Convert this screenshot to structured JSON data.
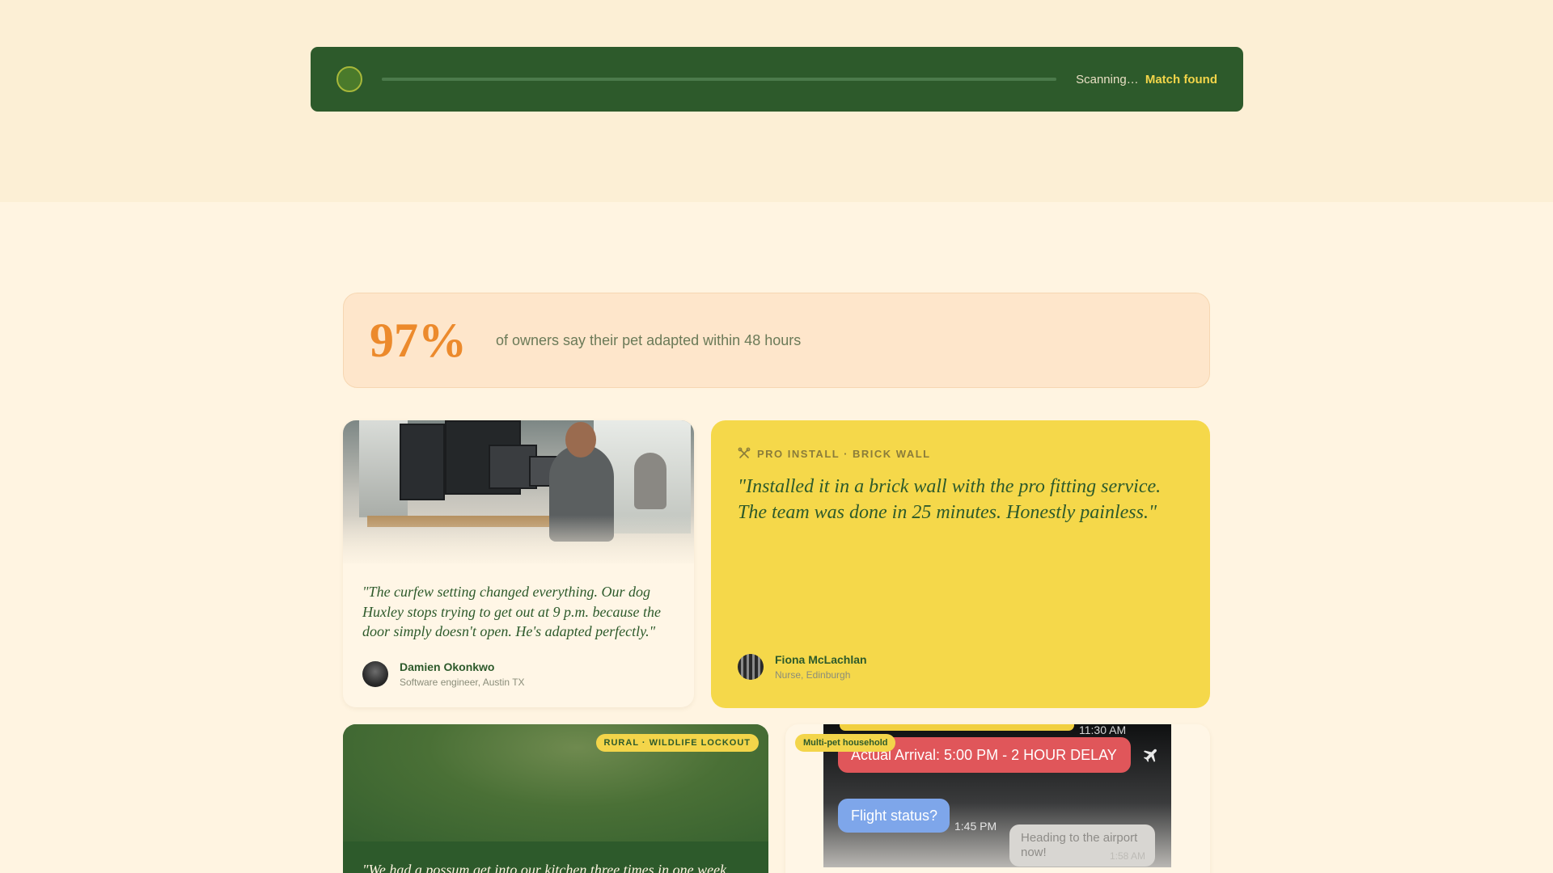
{
  "scan": {
    "status_label": "Scanning…",
    "match_label": "Match found",
    "progress": 1.0
  },
  "stat": {
    "value": "97%",
    "text": "of owners say their pet adapted within 48 hours"
  },
  "testimonials": {
    "damien": {
      "quote": "\"The curfew setting changed everything. Our dog Huxley stops trying to get out at 9 p.m. because the door simply doesn't open. He's adapted perfectly.\"",
      "name": "Damien Okonkwo",
      "role": "Software engineer, Austin TX"
    },
    "fiona": {
      "tag": "PRO INSTALL · BRICK WALL",
      "quote": "\"Installed it in a brick wall with the pro fitting service. The team was done in 25 minutes. Honestly painless.\"",
      "name": "Fiona McLachlan",
      "role": "Nurse, Edinburgh"
    },
    "rural": {
      "badge": "RURAL · WILDLIFE LOCKOUT",
      "quote": "\"We had a possum get into our kitchen three times in one week."
    },
    "chat": {
      "badge": "Multi-pet household",
      "time_top": "11:30 AM",
      "arrival": "Actual Arrival: 5:00 PM - 2 HOUR DELAY",
      "flight_status": "Flight status?",
      "time_blue": "1:45 PM",
      "grey_msg": "Heading to the airport now!",
      "grey_time": "1:58 AM"
    }
  },
  "colors": {
    "brand_green": "#2d5a2b",
    "accent_yellow": "#f3d54a",
    "stat_orange": "#ec8a2c"
  },
  "icons": {
    "scan": "status-dot-icon",
    "tag": "tools-icon",
    "plane": "airplane-icon"
  }
}
